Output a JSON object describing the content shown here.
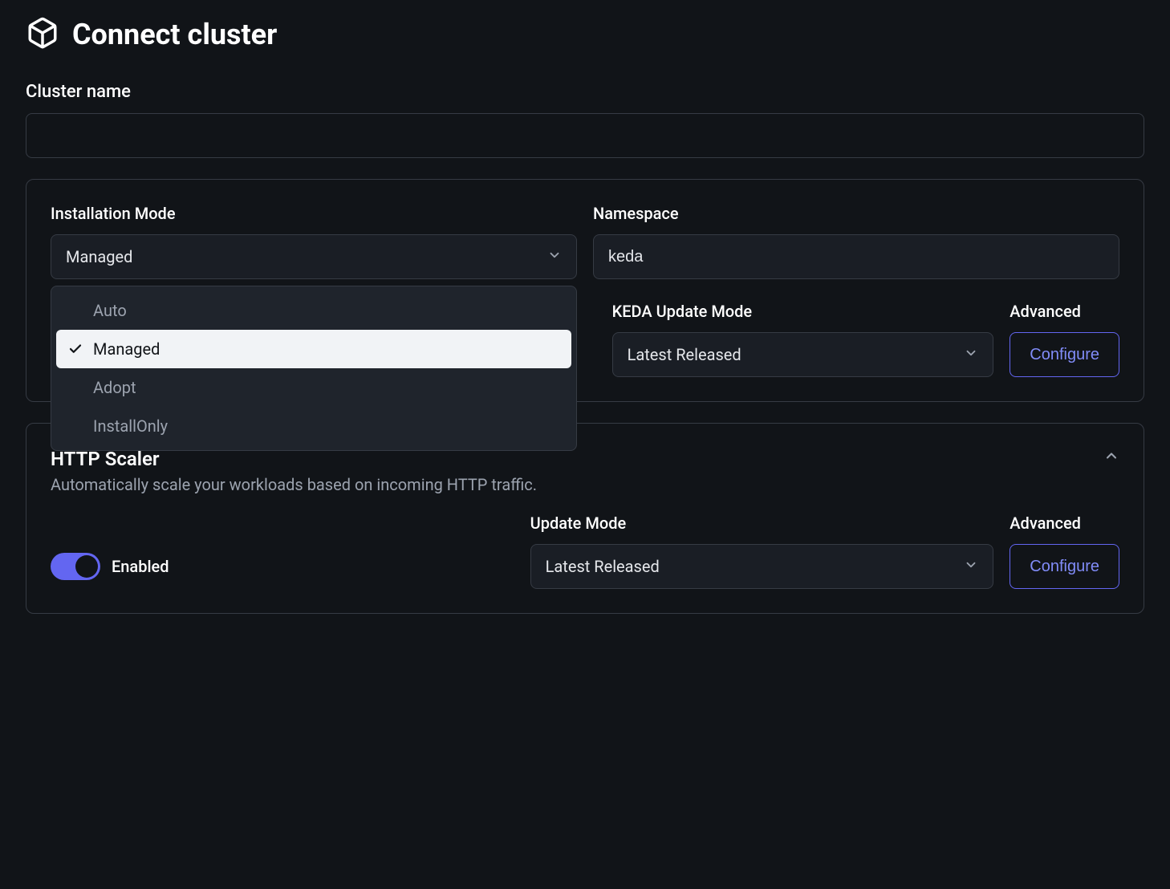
{
  "header": {
    "title": "Connect cluster"
  },
  "cluster_name": {
    "label": "Cluster name",
    "value": ""
  },
  "install_panel": {
    "installation_mode": {
      "label": "Installation Mode",
      "selected": "Managed",
      "options": [
        {
          "label": "Auto",
          "selected": false
        },
        {
          "label": "Managed",
          "selected": true
        },
        {
          "label": "Adopt",
          "selected": false
        },
        {
          "label": "InstallOnly",
          "selected": false
        }
      ]
    },
    "namespace": {
      "label": "Namespace",
      "value": "keda"
    },
    "keda_update_mode": {
      "label": "KEDA Update Mode",
      "selected": "Latest Released"
    },
    "advanced": {
      "label": "Advanced",
      "button": "Configure"
    }
  },
  "http_scaler": {
    "title": "HTTP Scaler",
    "description": "Automatically scale your workloads based on incoming HTTP traffic.",
    "enabled_label": "Enabled",
    "update_mode": {
      "label": "Update Mode",
      "selected": "Latest Released"
    },
    "advanced": {
      "label": "Advanced",
      "button": "Configure"
    }
  }
}
